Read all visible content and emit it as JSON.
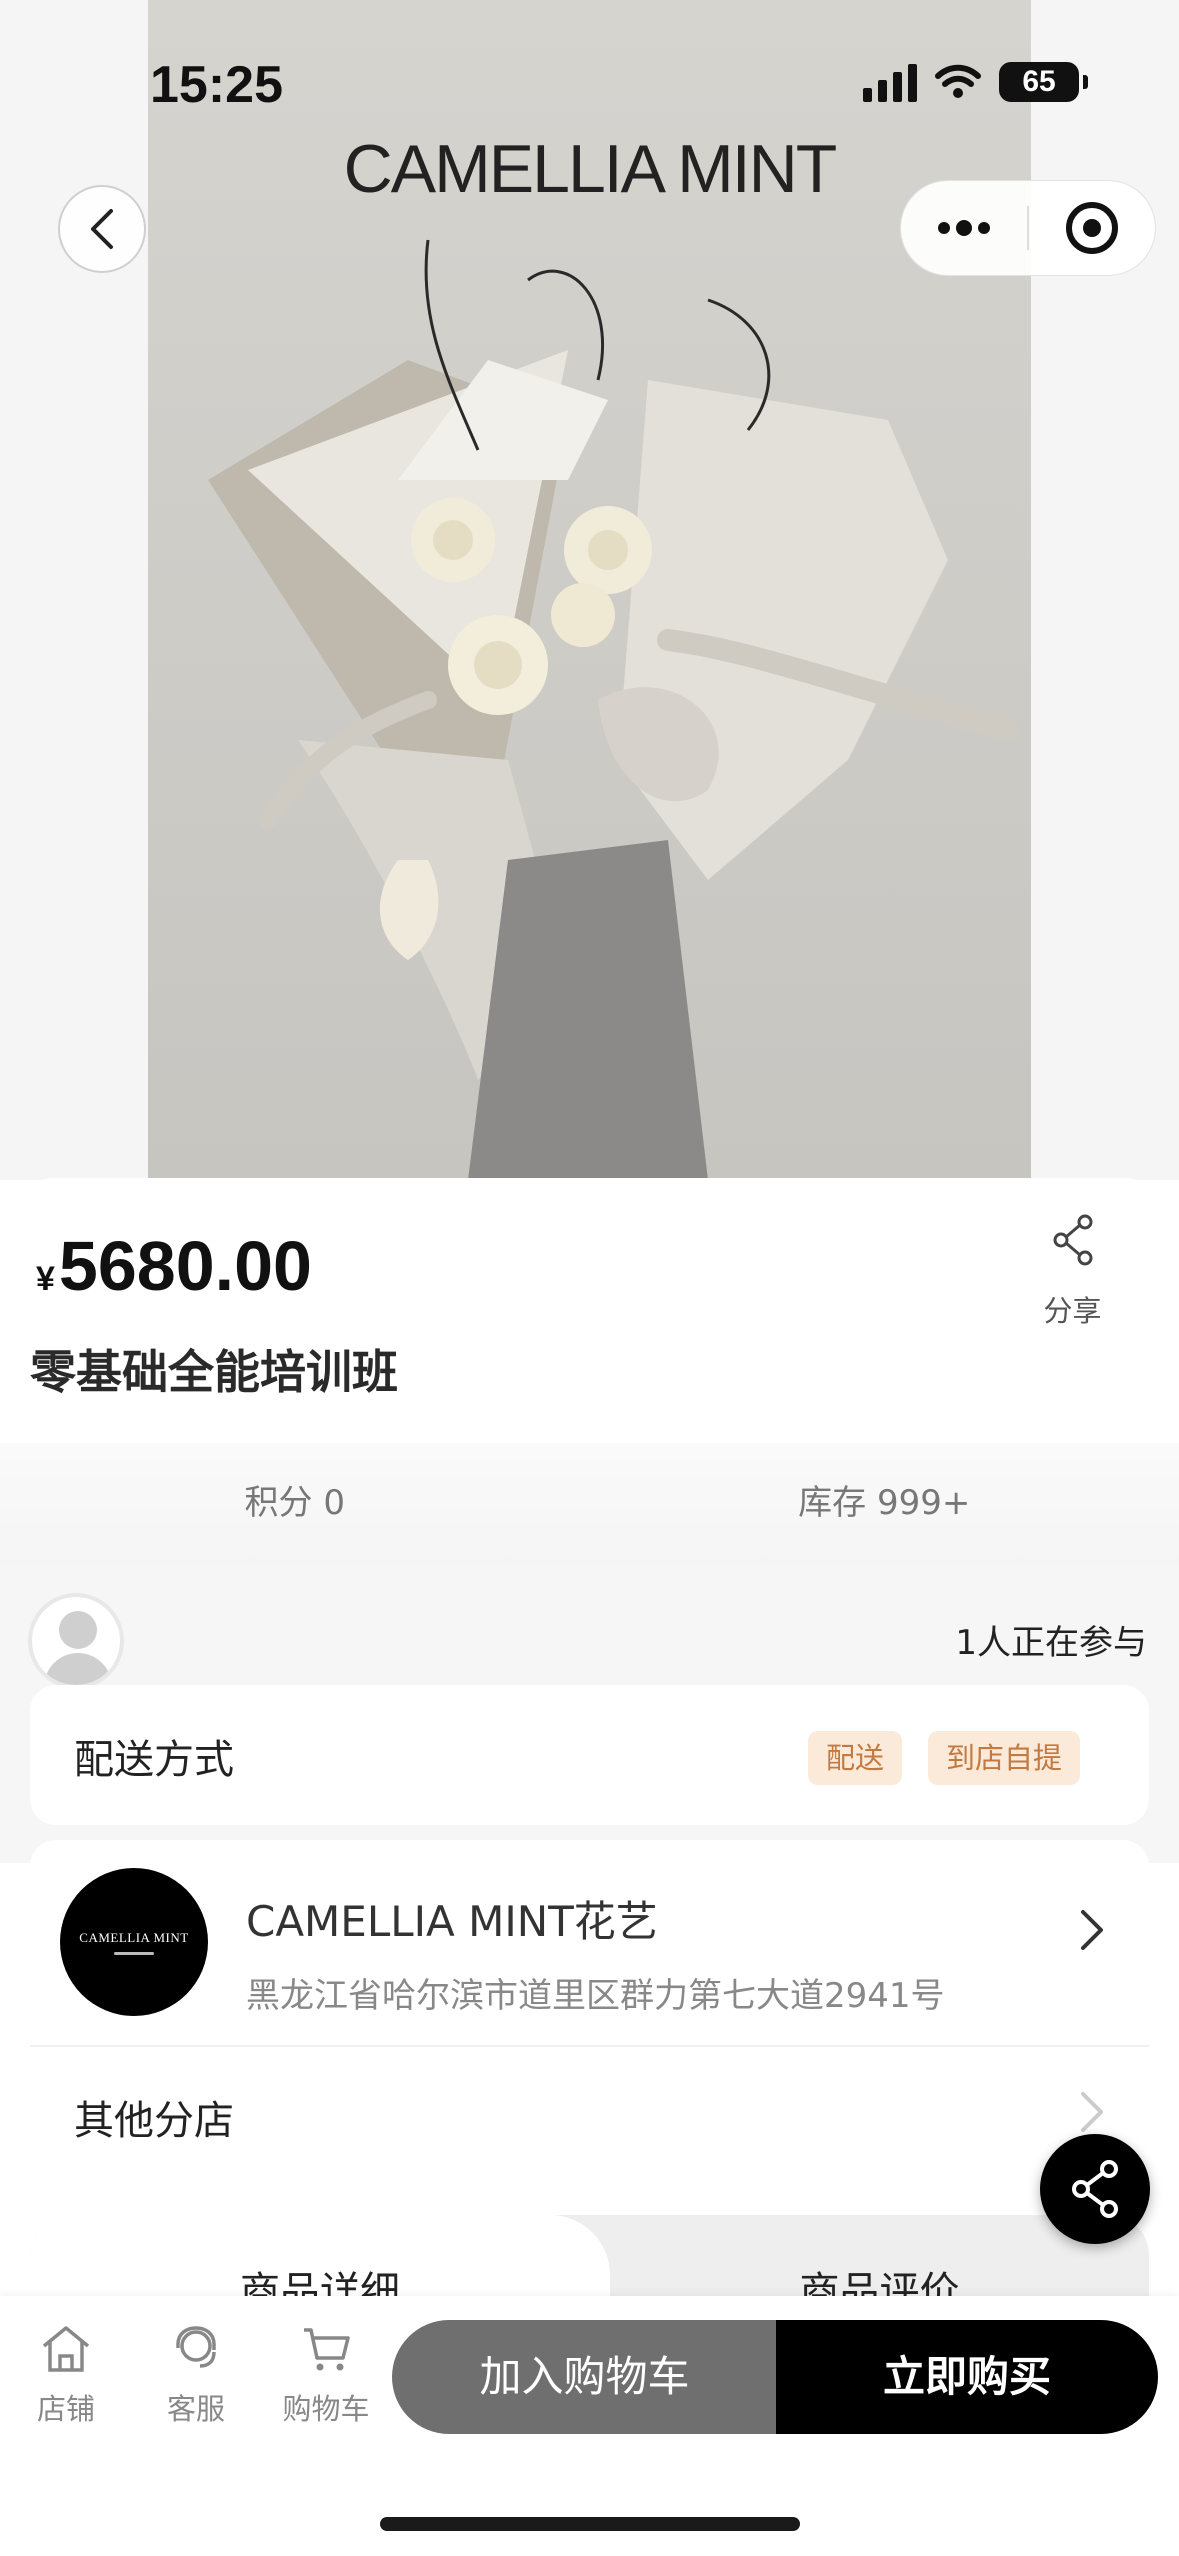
{
  "status_bar": {
    "time": "15:25",
    "battery": "65"
  },
  "hero": {
    "brand": "CAMELLIA MINT",
    "image_alt": "bouquet-photo"
  },
  "product": {
    "currency": "¥",
    "price": "5680.00",
    "share_label": "分享",
    "title": "零基础全能培训班",
    "points": "积分 0",
    "stock": "库存 999+",
    "participants": "1人正在参与"
  },
  "delivery": {
    "label": "配送方式",
    "options": [
      "配送",
      "到店自提"
    ]
  },
  "store": {
    "logo_text": "CAMELLIA MINT",
    "name": "CAMELLIA MINT花艺",
    "address": "黑龙江省哈尔滨市道里区群力第七大道2941号",
    "other_branches": "其他分店"
  },
  "tabs": [
    "商品详细",
    "商品评价"
  ],
  "bottom_nav": {
    "items": [
      {
        "label": "店铺",
        "icon": "store-icon"
      },
      {
        "label": "客服",
        "icon": "customer-service-icon"
      },
      {
        "label": "购物车",
        "icon": "cart-icon"
      }
    ],
    "add_to_cart": "加入购物车",
    "buy_now": "立即购买"
  },
  "colors": {
    "accent": "#000000",
    "tag_bg": "#fbe9da",
    "tag_text": "#c47a3f",
    "cart_btn": "#6f6f6f"
  }
}
